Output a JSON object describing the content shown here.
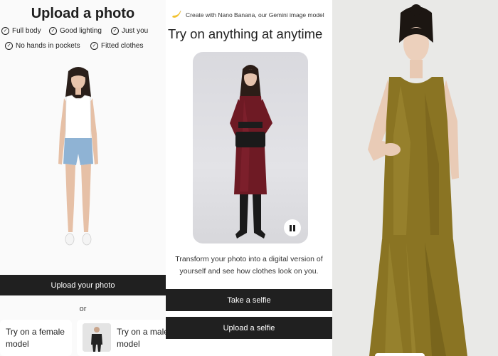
{
  "upload_panel": {
    "title": "Upload a photo",
    "checklist": [
      "Full body",
      "Good lighting",
      "Just you",
      "No hands in pockets",
      "Fitted clothes"
    ],
    "upload_button": "Upload your photo",
    "or_text": "or",
    "model_options": [
      {
        "label_line1": "Try on a female",
        "label_line2": "model"
      },
      {
        "label_line1": "Try on a male",
        "label_line2": "model"
      }
    ]
  },
  "try_on_panel": {
    "banner": "Create with Nano Banana, our Gemini image model",
    "title": "Try on anything at anytime",
    "description_line1": "Transform your photo into a digital version of",
    "description_line2": "yourself and see how clothes look on you.",
    "take_selfie_button": "Take a selfie",
    "upload_selfie_button": "Upload a selfie",
    "icons": {
      "banner": "banana-icon",
      "pause": "pause-icon"
    }
  },
  "colors": {
    "button_dark": "#202020",
    "dress_olive": "#8a7423",
    "velvet_burgundy": "#6e1a24"
  }
}
